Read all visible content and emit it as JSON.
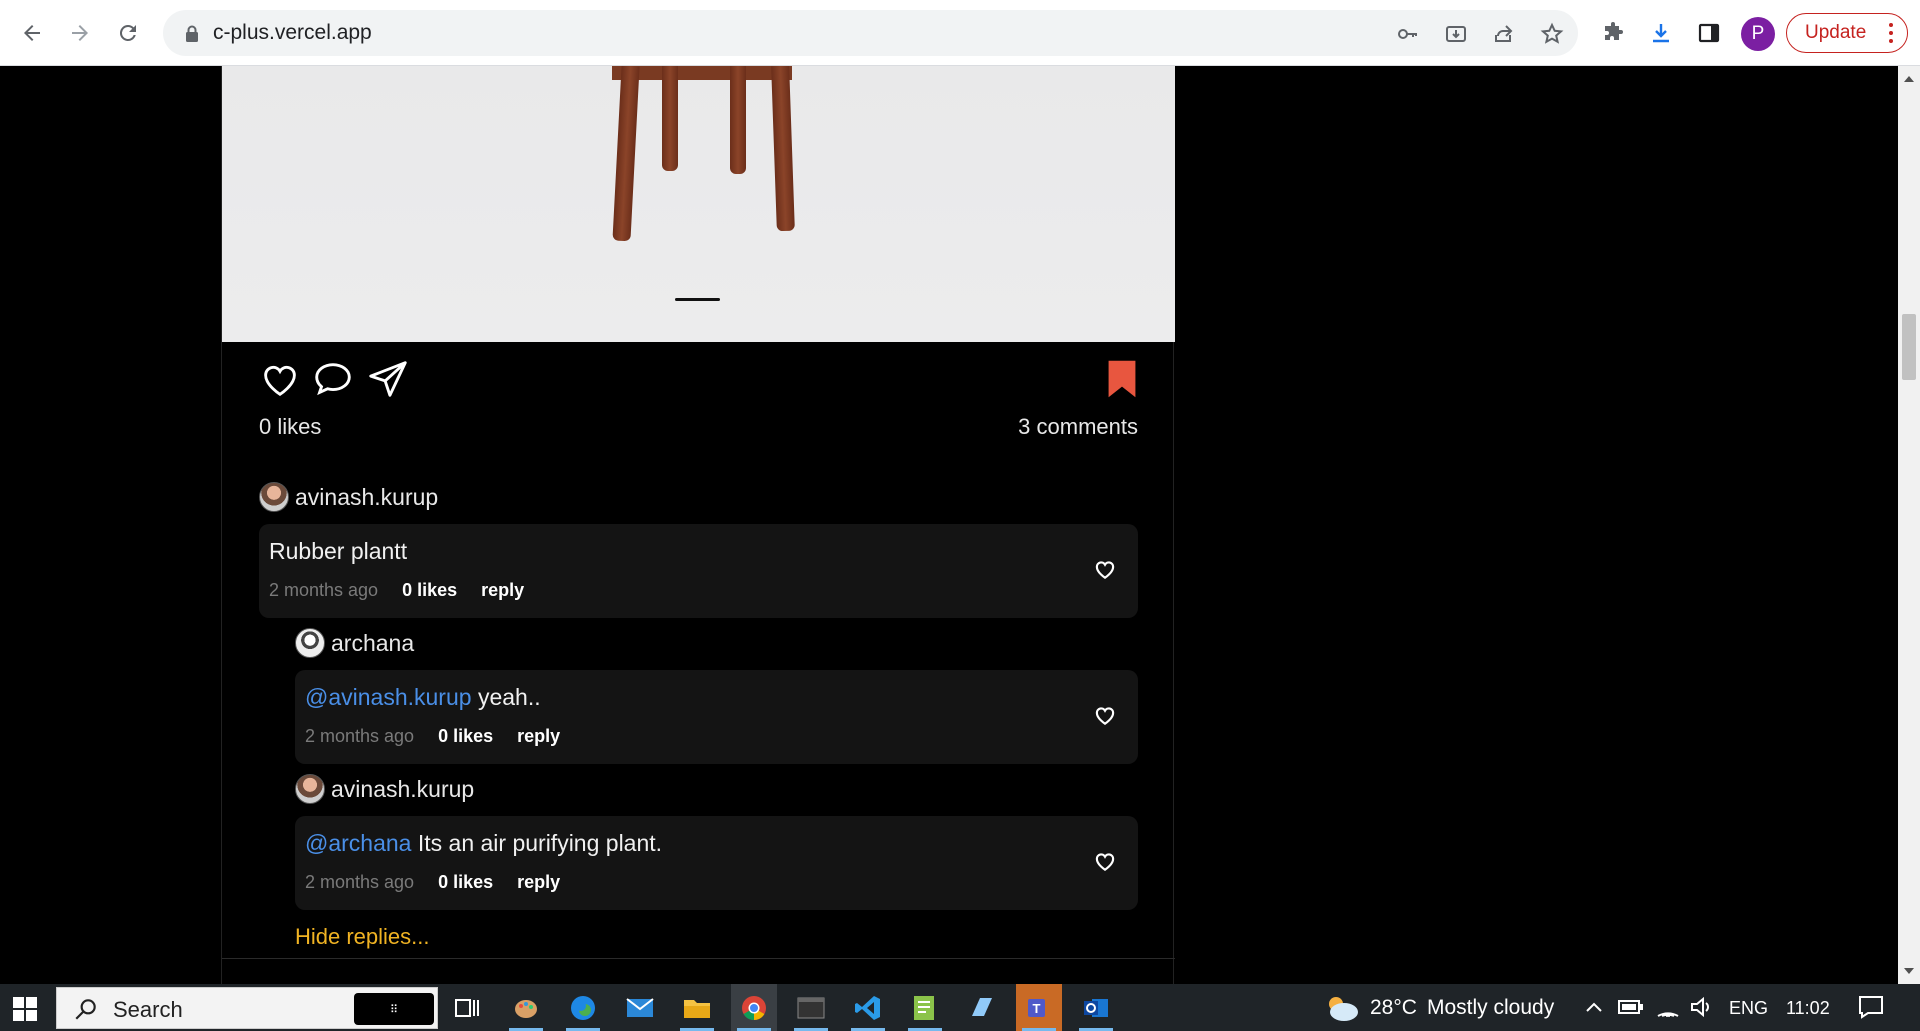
{
  "browser": {
    "url": "c-plus.vercel.app",
    "profile_initial": "P",
    "update_label": "Update",
    "icons": [
      "back-icon",
      "forward-icon",
      "reload-icon",
      "lock-icon",
      "key-icon",
      "install-icon",
      "share-icon",
      "star-icon",
      "extensions-icon",
      "download-icon",
      "sidepanel-icon"
    ]
  },
  "post": {
    "likes_label": "0 likes",
    "comments_label": "3 comments",
    "bookmark_color": "#e8563f"
  },
  "comments": [
    {
      "author": "avinash.kurup",
      "mention": "",
      "text": "Rubber plantt",
      "time": "2 months ago",
      "likes": "0 likes",
      "reply": "reply"
    },
    {
      "author": "archana",
      "mention": "@avinash.kurup",
      "text": " yeah..",
      "time": "2 months ago",
      "likes": "0 likes",
      "reply": "reply"
    },
    {
      "author": "avinash.kurup",
      "mention": "@archana",
      "text": " Its an air purifying plant.",
      "time": "2 months ago",
      "likes": "0 likes",
      "reply": "reply"
    }
  ],
  "hide_replies": "Hide replies...",
  "taskbar": {
    "search_placeholder": "Search",
    "weather_temp": "28°C",
    "weather_desc": "Mostly cloudy",
    "language": "ENG",
    "time": "11:02"
  }
}
